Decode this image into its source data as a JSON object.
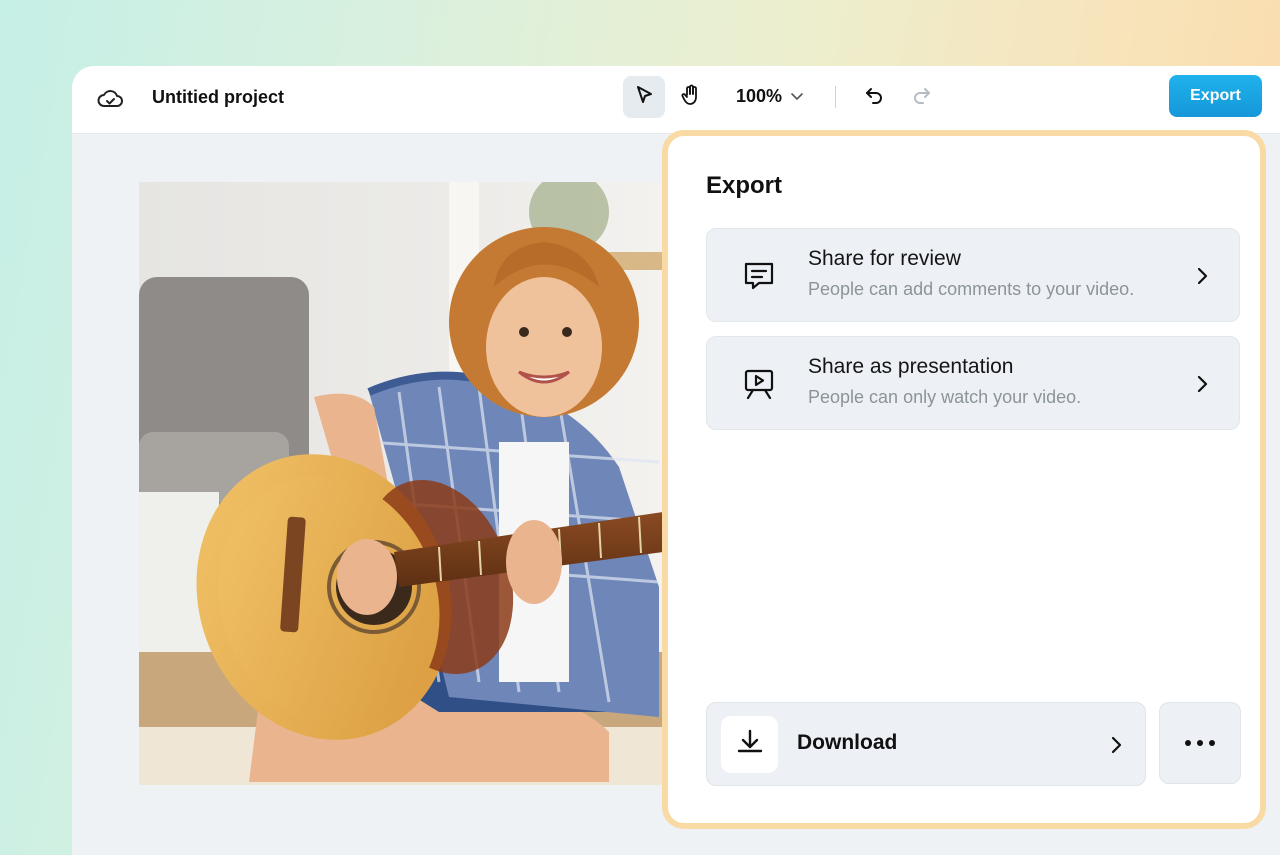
{
  "header": {
    "project_title": "Untitied project",
    "zoom_level": "100%",
    "export_label": "Export"
  },
  "export_panel": {
    "title": "Export",
    "options": [
      {
        "title": "Share for review",
        "subtitle": "People can add comments to your video.",
        "icon": "comment-icon"
      },
      {
        "title": "Share as presentation",
        "subtitle": "People can only watch your video.",
        "icon": "presentation-icon"
      }
    ],
    "download_label": "Download"
  },
  "colors": {
    "accent": "#1ba6e4",
    "panel_border": "#f9d9a4"
  }
}
